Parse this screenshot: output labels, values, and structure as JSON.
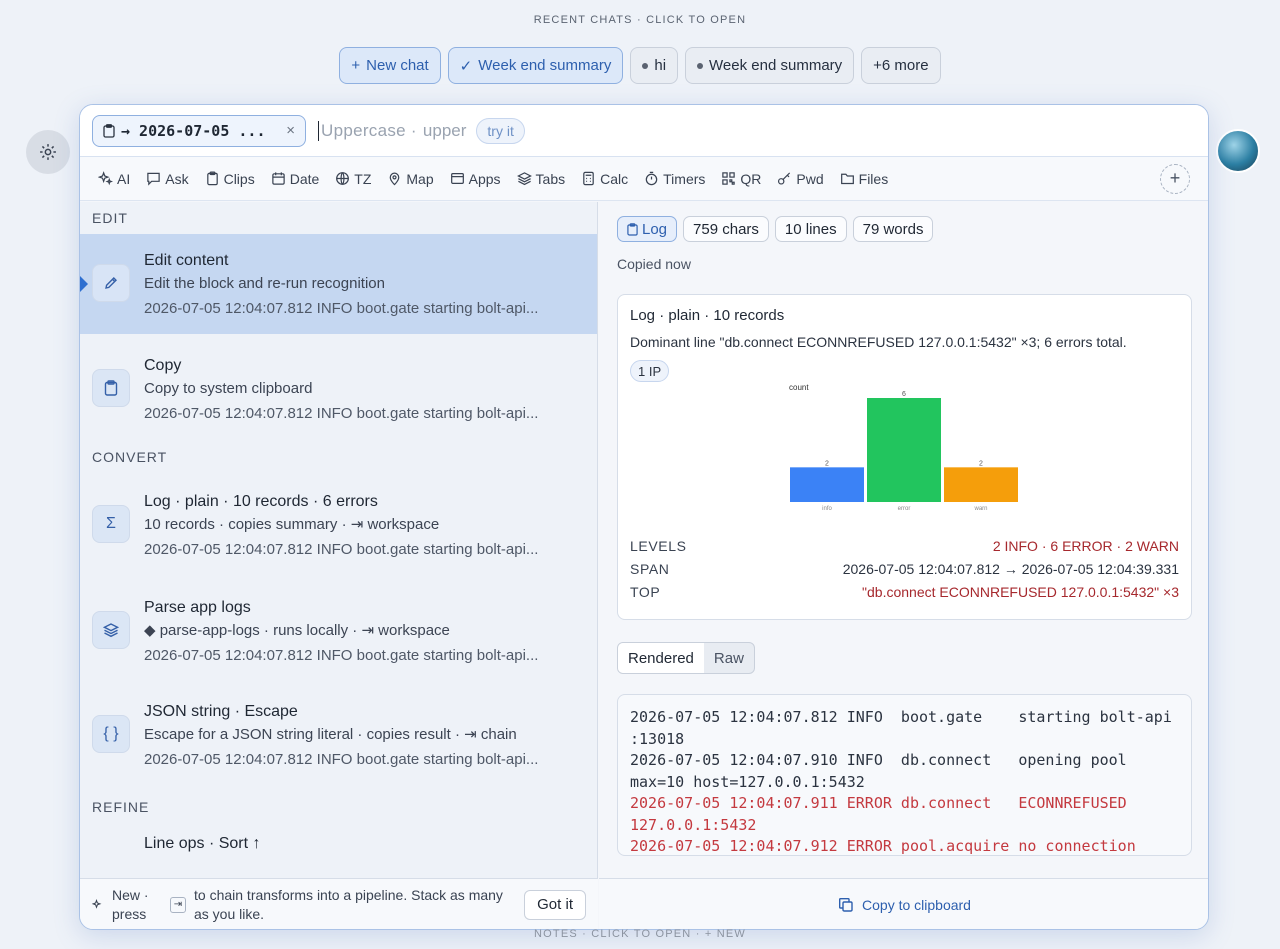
{
  "recent": {
    "caption": "RECENT CHATS · CLICK TO OPEN",
    "chips": [
      {
        "label": "New chat",
        "prefix": "+"
      },
      {
        "label": "Week end summary",
        "prefix": "✓"
      },
      {
        "label": "hi"
      },
      {
        "label": "Week end summary"
      },
      {
        "label": "+6 more"
      }
    ]
  },
  "search": {
    "source_chip": "→ 2026-07-05 ...",
    "clear": "×",
    "placeholder_a": "Uppercase ·",
    "placeholder_b": "upper",
    "try_label": "try it"
  },
  "tools": [
    {
      "label": "AI",
      "icon": "sparkle-icon"
    },
    {
      "label": "Ask",
      "icon": "chat-icon"
    },
    {
      "label": "Clips",
      "icon": "clipboard-icon"
    },
    {
      "label": "Date",
      "icon": "calendar-icon"
    },
    {
      "label": "TZ",
      "icon": "globe-icon"
    },
    {
      "label": "Map",
      "icon": "pin-icon"
    },
    {
      "label": "Apps",
      "icon": "window-icon"
    },
    {
      "label": "Tabs",
      "icon": "layers-icon"
    },
    {
      "label": "Calc",
      "icon": "calculator-icon"
    },
    {
      "label": "Timers",
      "icon": "timer-icon"
    },
    {
      "label": "QR",
      "icon": "qr-icon"
    },
    {
      "label": "Pwd",
      "icon": "key-icon"
    },
    {
      "label": "Files",
      "icon": "folder-icon"
    }
  ],
  "left": {
    "sections": {
      "edit": "EDIT",
      "convert": "CONVERT",
      "refine": "REFINE"
    },
    "items": [
      {
        "title": "Edit content",
        "sub": "Edit the block and re-run recognition",
        "preview": "2026-07-05 12:04:07.812 INFO boot.gate starting bolt-api..."
      },
      {
        "title": "Copy",
        "sub": "Copy to system clipboard",
        "preview": "2026-07-05 12:04:07.812 INFO boot.gate starting bolt-api..."
      },
      {
        "title": "Log · plain · 10 records · 6 errors",
        "sub": "10 records · copies summary · ⇥ workspace",
        "preview": "2026-07-05 12:04:07.812 INFO boot.gate starting bolt-api..."
      },
      {
        "title": "Parse app logs",
        "sub": "◆ parse-app-logs · runs locally · ⇥ workspace",
        "preview": "2026-07-05 12:04:07.812 INFO boot.gate starting bolt-api..."
      },
      {
        "title": "JSON string · Escape",
        "sub": "Escape for a JSON string literal · copies result · ⇥ chain",
        "preview": "2026-07-05 12:04:07.812 INFO boot.gate starting bolt-api..."
      }
    ],
    "line_ops": "Line ops · Sort ↑",
    "tip": {
      "new": "New ·",
      "press": "press",
      "text": "to chain transforms into a pipeline. Stack as many as you like.",
      "button": "Got it"
    }
  },
  "right": {
    "stats": [
      "Log",
      "759 chars",
      "10 lines",
      "79 words"
    ],
    "copied": "Copied now",
    "card_title": "Log · plain · 10 records",
    "card_desc": "Dominant line \"db.connect ECONNREFUSED 127.0.0.1:5432\" ×3; 6 errors total.",
    "ip_chip": "1 IP",
    "kv": [
      {
        "k": "LEVELS",
        "v": "2 INFO · 6 ERROR · 2 WARN",
        "red": true
      },
      {
        "k": "SPAN",
        "v": "2026-07-05 12:04:07.812 → 2026-07-05 12:04:39.331",
        "red": false
      },
      {
        "k": "TOP",
        "v": "\"db.connect ECONNREFUSED 127.0.0.1:5432\" ×3",
        "red": true
      }
    ],
    "tabs": [
      "Rendered",
      "Raw"
    ],
    "raw_lines": [
      {
        "text": "2026-07-05 12:04:07.812 INFO  boot.gate    starting bolt-api",
        "err": false
      },
      {
        "text": ":13018",
        "err": false
      },
      {
        "text": "2026-07-05 12:04:07.910 INFO  db.connect   opening pool",
        "err": false
      },
      {
        "text": "max=10 host=127.0.0.1:5432",
        "err": false
      },
      {
        "text": "2026-07-05 12:04:07.911 ERROR db.connect   ECONNREFUSED",
        "err": true
      },
      {
        "text": "127.0.0.1:5432",
        "err": true
      },
      {
        "text": "2026-07-05 12:04:07.912 ERROR pool.acquire no connection",
        "err": true
      }
    ],
    "copy_button": "Copy to clipboard"
  },
  "chart_data": {
    "type": "bar",
    "ylabel": "count",
    "categories": [
      "info",
      "error",
      "warn"
    ],
    "values": [
      2,
      6,
      2
    ],
    "colors": [
      "#3b82f6",
      "#22c55e",
      "#f59e0b"
    ],
    "ylim": [
      0,
      6
    ]
  },
  "notes": {
    "caption": "NOTES · CLICK TO OPEN · + NEW"
  }
}
